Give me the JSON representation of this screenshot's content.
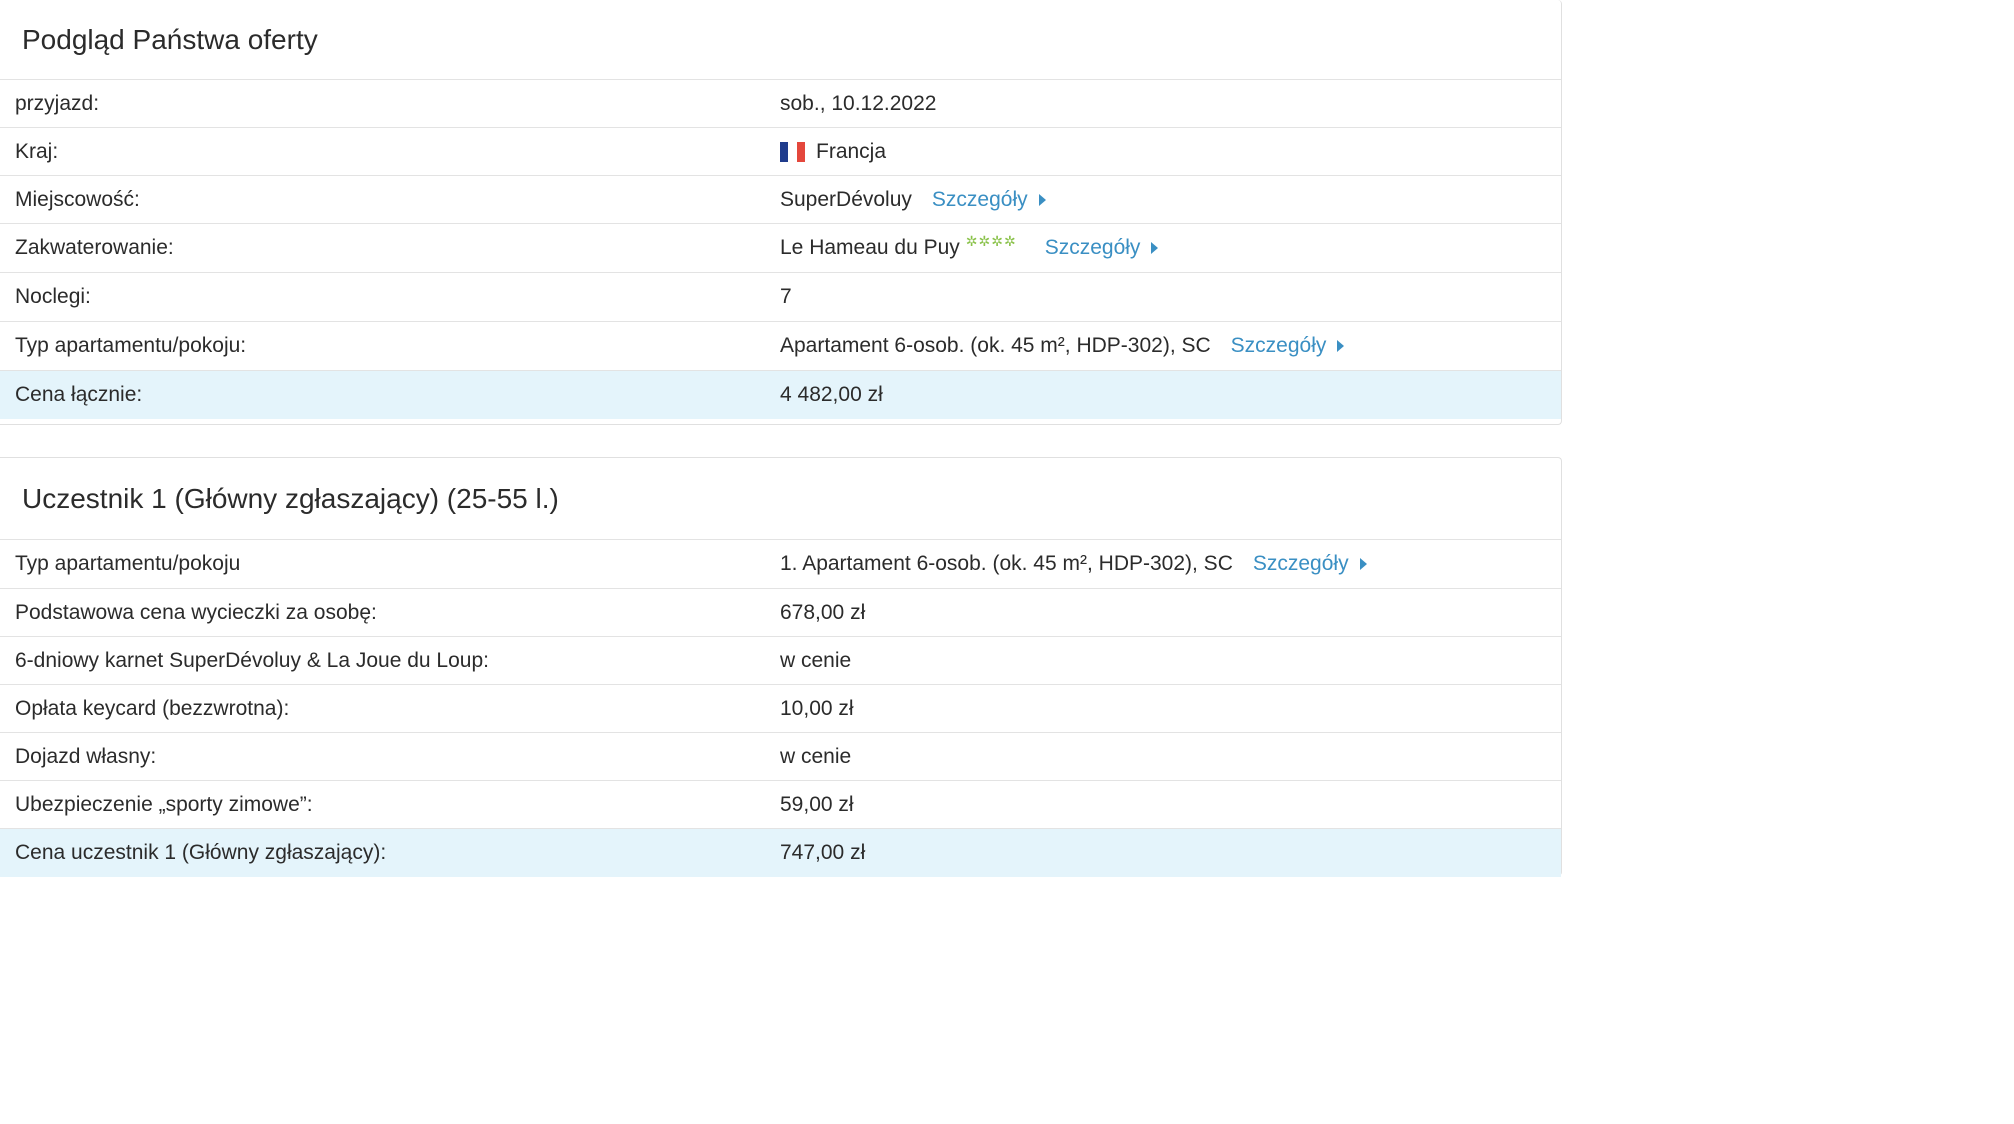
{
  "offer": {
    "title": "Podgląd Państwa oferty",
    "rows": {
      "arrival": {
        "label": "przyjazd:",
        "value": "sob., 10.12.2022"
      },
      "country": {
        "label": "Kraj:",
        "value": "Francja"
      },
      "place": {
        "label": "Miejscowość:",
        "value": "SuperDévoluy",
        "link": "Szczegóły"
      },
      "accommodation": {
        "label": "Zakwaterowanie:",
        "value": "Le Hameau du Puy",
        "stars": "✲✲✲✲",
        "link": "Szczegóły"
      },
      "nights": {
        "label": "Noclegi:",
        "value": "7"
      },
      "room_type": {
        "label": "Typ apartamentu/pokoju:",
        "value": "Apartament 6-osob. (ok. 45 m², HDP-302), SC",
        "link": "Szczegóły"
      },
      "total": {
        "label": "Cena łącznie:",
        "value": "4 482,00 zł"
      }
    }
  },
  "participant": {
    "title": "Uczestnik 1 (Główny zgłaszający) (25-55 l.)",
    "rows": {
      "room_type": {
        "label": "Typ apartamentu/pokoju",
        "value": "1. Apartament 6-osob. (ok. 45 m², HDP-302), SC",
        "link": "Szczegóły"
      },
      "base_price": {
        "label": "Podstawowa cena wycieczki za osobę:",
        "value": "678,00 zł"
      },
      "ski_pass": {
        "label": "6-dniowy karnet SuperDévoluy & La Joue du Loup:",
        "value": "w cenie"
      },
      "keycard": {
        "label": "Opłata keycard (bezzwrotna):",
        "value": "10,00 zł"
      },
      "travel": {
        "label": "Dojazd własny:",
        "value": "w cenie"
      },
      "insurance": {
        "label": "Ubezpieczenie „sporty zimowe”:",
        "value": "59,00 zł"
      },
      "total": {
        "label": "Cena uczestnik 1 (Główny zgłaszający):",
        "value": "747,00 zł"
      }
    }
  },
  "colors": {
    "link": "#3a8fc3",
    "highlight_row": "#e4f4fb",
    "stars": "#8ac24a"
  },
  "icons": {
    "flag": "flag-france-icon",
    "arrow": "caret-right-icon",
    "stars": "rating-stars-icon"
  }
}
